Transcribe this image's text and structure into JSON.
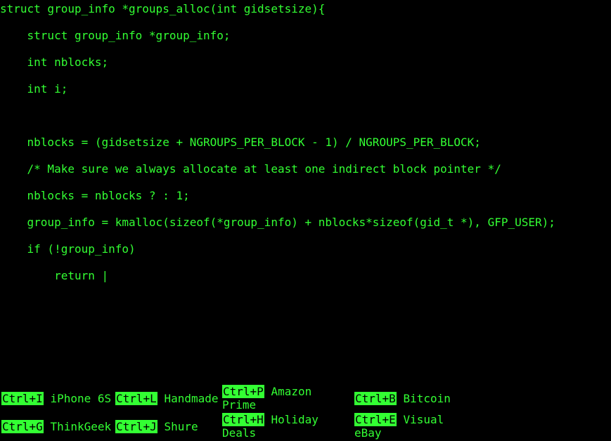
{
  "colors": {
    "background": "#000000",
    "text": "#33ff33",
    "key_bg": "#33ff33",
    "key_text": "#000000"
  },
  "editor": {
    "lines": [
      "struct group_info *groups_alloc(int gidsetsize){",
      "    struct group_info *group_info;",
      "    int nblocks;",
      "    int i;",
      "",
      "    nblocks = (gidsetsize + NGROUPS_PER_BLOCK - 1) / NGROUPS_PER_BLOCK;",
      "    /* Make sure we always allocate at least one indirect block pointer */",
      "    nblocks = nblocks ? : 1;",
      "    group_info = kmalloc(sizeof(*group_info) + nblocks*sizeof(gid_t *), GFP_USER);",
      "    if (!group_info)",
      "        return |"
    ]
  },
  "shortcuts": [
    {
      "key": "Ctrl+I",
      "label": "iPhone 6S"
    },
    {
      "key": "Ctrl+L",
      "label": "Handmade"
    },
    {
      "key": "Ctrl+P",
      "label": "Amazon Prime"
    },
    {
      "key": "Ctrl+B",
      "label": "Bitcoin"
    },
    {
      "key": "Ctrl+G",
      "label": "ThinkGeek"
    },
    {
      "key": "Ctrl+J",
      "label": "Shure"
    },
    {
      "key": "Ctrl+H",
      "label": "Holiday Deals"
    },
    {
      "key": "Ctrl+E",
      "label": "Visual eBay"
    }
  ]
}
